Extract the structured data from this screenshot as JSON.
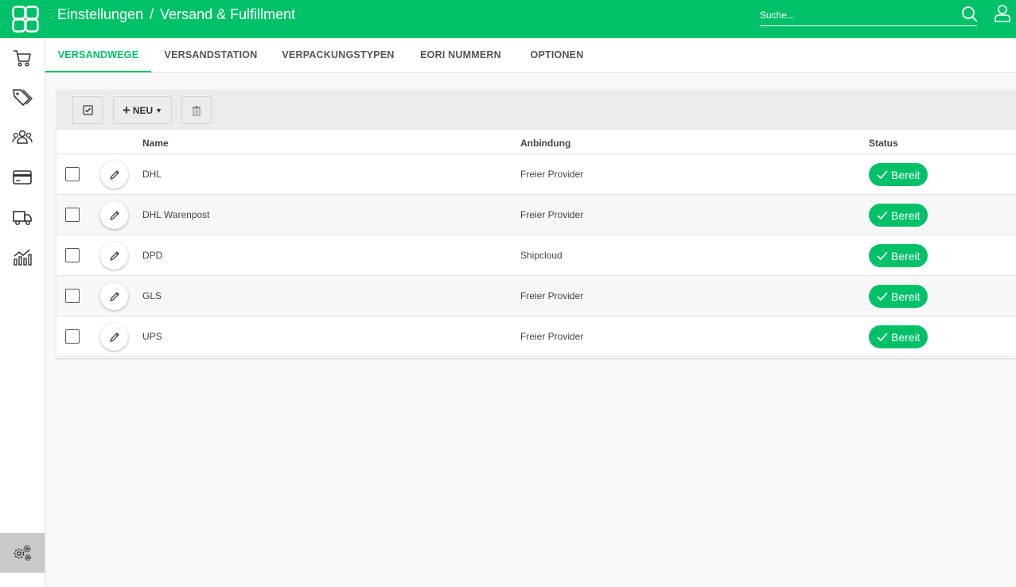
{
  "header": {
    "breadcrumb_1": "Einstellungen",
    "separator": "/",
    "breadcrumb_2": "Versand & Fulfillment",
    "search_placeholder": "Suche...",
    "accent_color": "#00c168"
  },
  "sidebar": {
    "items": [
      {
        "icon": "cart-icon"
      },
      {
        "icon": "tags-icon"
      },
      {
        "icon": "customers-icon"
      },
      {
        "icon": "payment-card-icon"
      },
      {
        "icon": "truck-icon"
      },
      {
        "icon": "analytics-icon"
      },
      {
        "icon": "settings-gears-icon",
        "active": true
      }
    ]
  },
  "tabs": [
    {
      "label": "VERSANDWEGE",
      "active": true
    },
    {
      "label": "VERSANDSTATION"
    },
    {
      "label": "VERPACKUNGSTYPEN"
    },
    {
      "label": "EORI NUMMERN"
    },
    {
      "label": "OPTIONEN"
    }
  ],
  "toolbar": {
    "new_label": "NEU"
  },
  "table": {
    "columns": [
      "Name",
      "Anbindung",
      "Status"
    ],
    "rows": [
      {
        "name": "DHL",
        "anbindung": "Freier Provider",
        "status": "Bereit"
      },
      {
        "name": "DHL Warenpost",
        "anbindung": "Freier Provider",
        "status": "Bereit"
      },
      {
        "name": "DPD",
        "anbindung": "Shipcloud",
        "status": "Bereit"
      },
      {
        "name": "GLS",
        "anbindung": "Freier Provider",
        "status": "Bereit"
      },
      {
        "name": "UPS",
        "anbindung": "Freier Provider",
        "status": "Bereit"
      }
    ]
  }
}
